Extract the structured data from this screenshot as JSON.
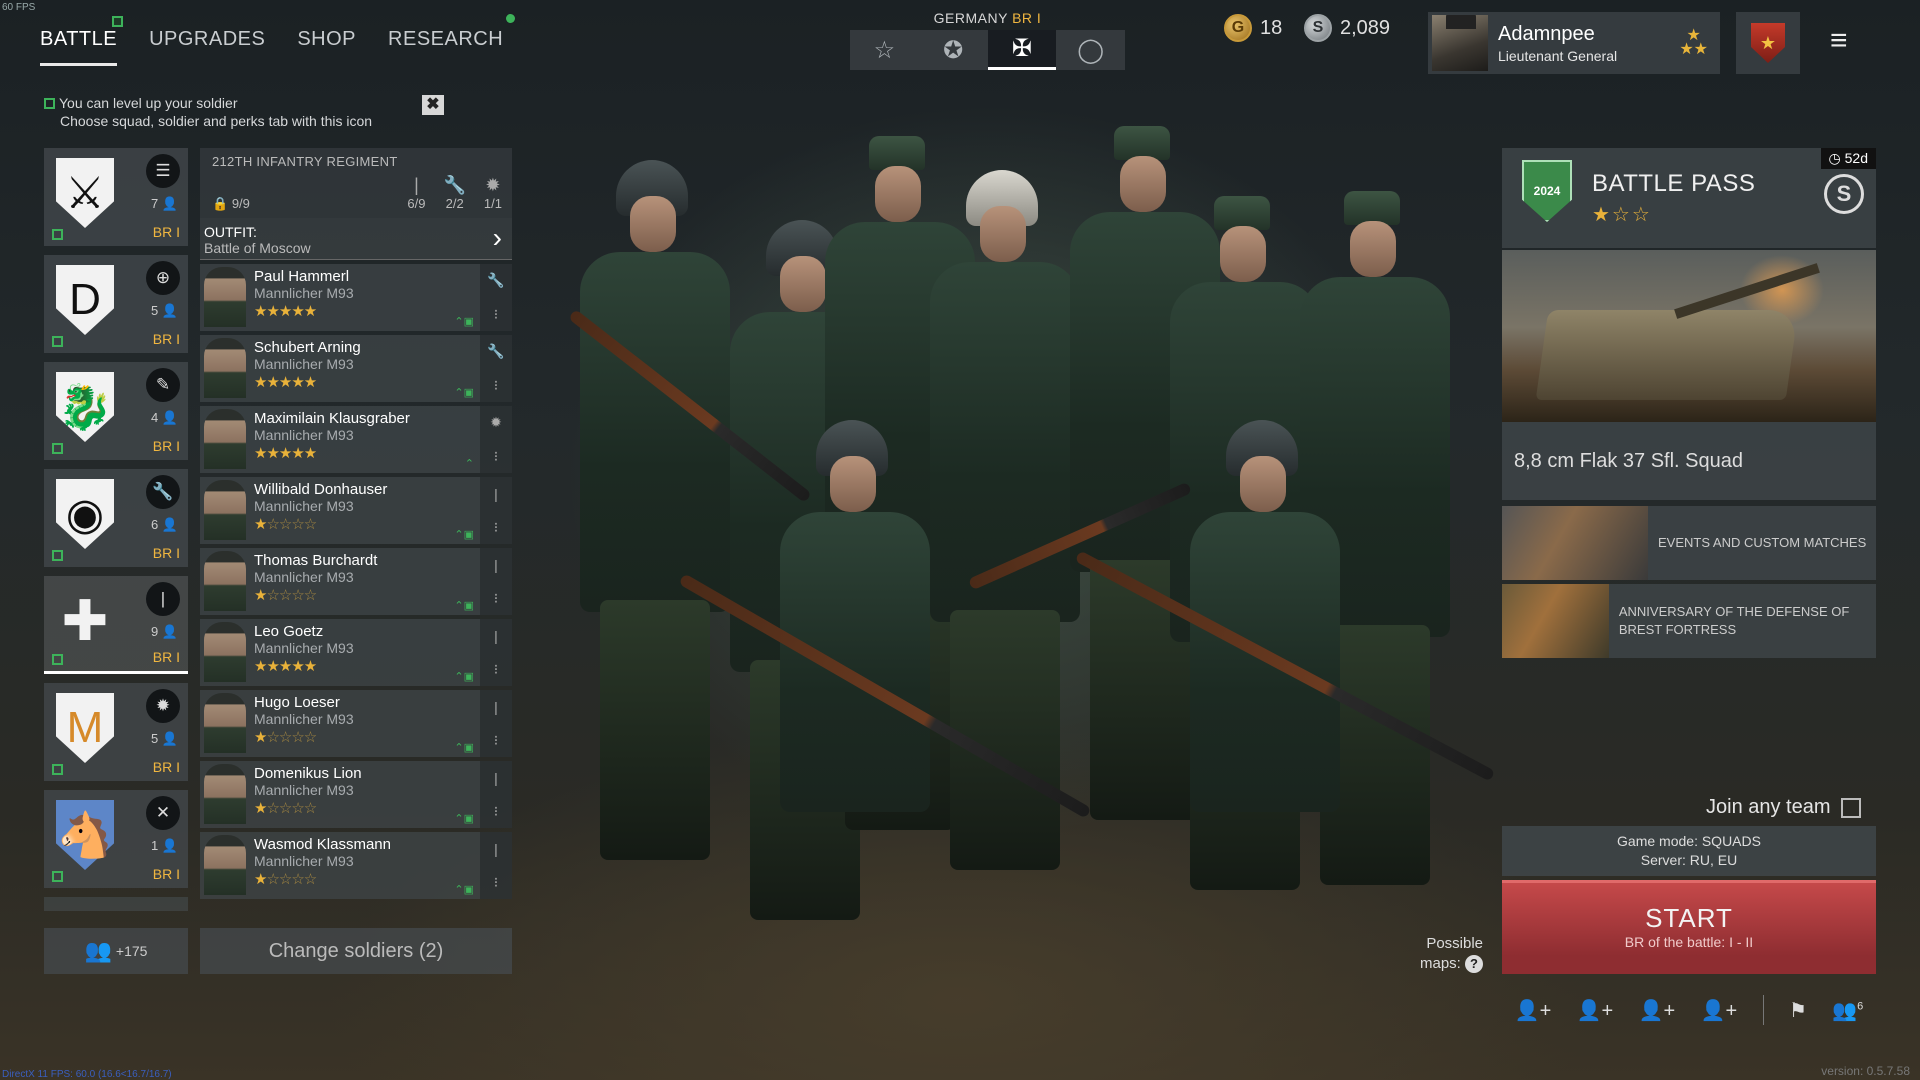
{
  "debug": {
    "fps": "60 FPS",
    "directx": "DirectX 11 FPS: 60.0 (16.6<16.7/16.7)",
    "version": "version: 0.5.7.58"
  },
  "nav": {
    "tabs": [
      {
        "label": "BATTLE"
      },
      {
        "label": "UPGRADES"
      },
      {
        "label": "SHOP"
      },
      {
        "label": "RESEARCH"
      }
    ]
  },
  "hint": {
    "line1": "You can level up your soldier",
    "line2": "Choose squad, soldier and perks tab with this icon",
    "close": "✖"
  },
  "nation": {
    "name": "GERMANY",
    "br": "BR I",
    "icons": [
      "☆",
      "✪",
      "✠",
      "◯"
    ]
  },
  "currency": {
    "gold": "18",
    "gold_symbol": "G",
    "silver": "2,089",
    "silver_symbol": "S"
  },
  "profile": {
    "name": "Adamnpee",
    "rank": "Lieutenant General",
    "rank_stars": "★\n★★"
  },
  "menu_icon": "≡",
  "squads": [
    {
      "emblem": "⚔",
      "icon": "☰",
      "count": "7",
      "br": "BR I"
    },
    {
      "emblem": "D",
      "icon": "⊕",
      "count": "5",
      "br": "BR I"
    },
    {
      "emblem": "🐉",
      "icon": "✎",
      "count": "4",
      "br": "BR I"
    },
    {
      "emblem": "◉",
      "icon": "🔧",
      "count": "6",
      "br": "BR I"
    },
    {
      "emblem": "✚",
      "icon": "|",
      "count": "9",
      "br": "BR I"
    },
    {
      "emblem": "M",
      "icon": "✹",
      "count": "5",
      "br": "BR I"
    },
    {
      "emblem": "🐴",
      "icon": "✕",
      "count": "1",
      "br": "BR I"
    }
  ],
  "reserve": {
    "icon": "👥",
    "count": "+175"
  },
  "regiment": {
    "name": "212TH INFANTRY REGIMENT",
    "slots": "9/9",
    "cols": [
      {
        "icon": "|",
        "value": "6/9"
      },
      {
        "icon": "🔧",
        "value": "2/2"
      },
      {
        "icon": "✹",
        "value": "1/1"
      }
    ]
  },
  "outfit": {
    "label": "OUTFIT:",
    "value": "Battle of Moscow",
    "chevron": "›"
  },
  "soldiers": [
    {
      "name": "Paul Hammerl",
      "weapon": "Mannlicher M93",
      "stars_on": "★★★★★",
      "stars_off": "",
      "side1": "🔧",
      "side2": "⁝"
    },
    {
      "name": "Schubert Arning",
      "weapon": "Mannlicher M93",
      "stars_on": "★★★★★",
      "stars_off": "",
      "side1": "🔧",
      "side2": "⁝"
    },
    {
      "name": "Maximilain Klausgraber",
      "weapon": "Mannlicher M93",
      "stars_on": "★★★★★",
      "stars_off": "",
      "side1": "✹",
      "side2": "⁝"
    },
    {
      "name": "Willibald Donhauser",
      "weapon": "Mannlicher M93",
      "stars_on": "★",
      "stars_off": "☆☆☆☆",
      "side1": "|",
      "side2": "⁝"
    },
    {
      "name": "Thomas Burchardt",
      "weapon": "Mannlicher M93",
      "stars_on": "★",
      "stars_off": "☆☆☆☆",
      "side1": "|",
      "side2": "⁝"
    },
    {
      "name": "Leo Goetz",
      "weapon": "Mannlicher M93",
      "stars_on": "★★★★★",
      "stars_off": "",
      "side1": "|",
      "side2": "⁝"
    },
    {
      "name": "Hugo Loeser",
      "weapon": "Mannlicher M93",
      "stars_on": "★",
      "stars_off": "☆☆☆☆",
      "side1": "|",
      "side2": "⁝"
    },
    {
      "name": "Domenikus Lion",
      "weapon": "Mannlicher M93",
      "stars_on": "★",
      "stars_off": "☆☆☆☆",
      "side1": "|",
      "side2": "⁝"
    },
    {
      "name": "Wasmod Klassmann",
      "weapon": "Mannlicher M93",
      "stars_on": "★",
      "stars_off": "☆☆☆☆",
      "side1": "|",
      "side2": "⁝"
    }
  ],
  "change_soldiers": "Change soldiers (2)",
  "battle_pass": {
    "title": "BATTLE PASS",
    "stars": "★☆☆",
    "timer": "◷ 52d",
    "logo": "2024",
    "currency": "S"
  },
  "featured": {
    "label": "8,8 cm Flak 37 Sfl. Squad"
  },
  "events": [
    {
      "label": "EVENTS AND CUSTOM MATCHES"
    },
    {
      "label": "ANNIVERSARY OF THE DEFENSE OF BREST FORTRESS"
    }
  ],
  "join_any_team": "Join any team",
  "game_mode": {
    "mode": "Game mode: SQUADS",
    "server": "Server: RU, EU"
  },
  "start": {
    "label": "START",
    "br": "BR of the battle: I - II"
  },
  "possible_maps": {
    "line1": "Possible",
    "line2": "maps:",
    "q": "?"
  },
  "bottom_bar": {
    "invites": [
      "👤+",
      "👤+",
      "👤+",
      "👤+"
    ],
    "flag": "⚑",
    "group": "👥",
    "group_count": "6"
  }
}
